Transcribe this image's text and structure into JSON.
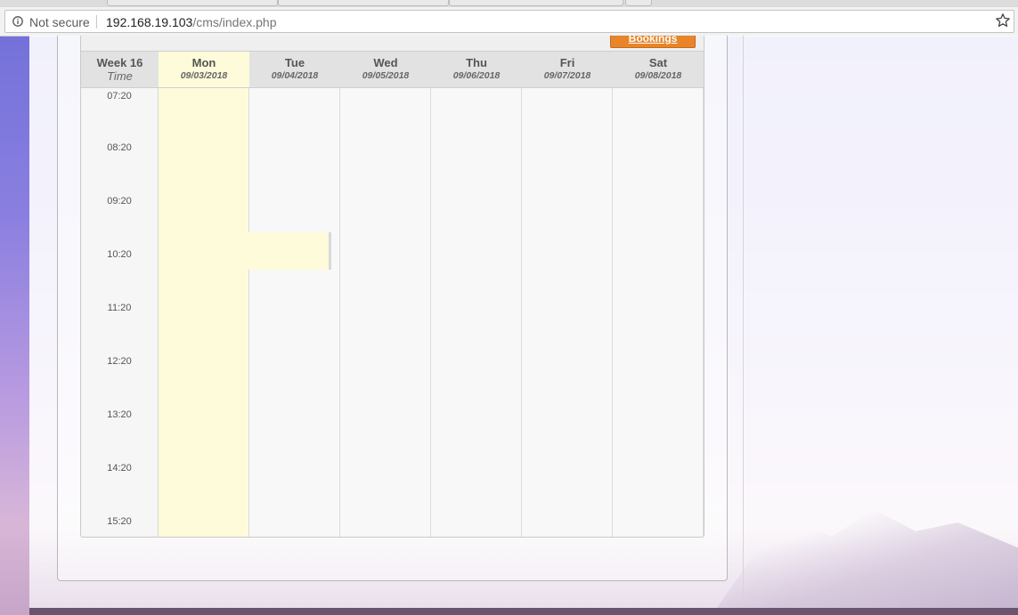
{
  "browser": {
    "security_label": "Not secure",
    "url_host": "192.168.19.103",
    "url_path": "/cms/index.php"
  },
  "calendar": {
    "bookings_button": "Bookings",
    "week_label": "Week 16",
    "time_label": "Time",
    "days": [
      {
        "name": "Mon",
        "date": "09/03/2018"
      },
      {
        "name": "Tue",
        "date": "09/04/2018"
      },
      {
        "name": "Wed",
        "date": "09/05/2018"
      },
      {
        "name": "Thu",
        "date": "09/06/2018"
      },
      {
        "name": "Fri",
        "date": "09/07/2018"
      },
      {
        "name": "Sat",
        "date": "09/08/2018"
      }
    ],
    "times": [
      "07:20",
      "08:20",
      "09:20",
      "10:20",
      "11:20",
      "12:20",
      "13:20",
      "14:20",
      "15:20"
    ],
    "colors": {
      "today_highlight": "#fdfbda",
      "bookings_button": "#e8842a"
    }
  }
}
